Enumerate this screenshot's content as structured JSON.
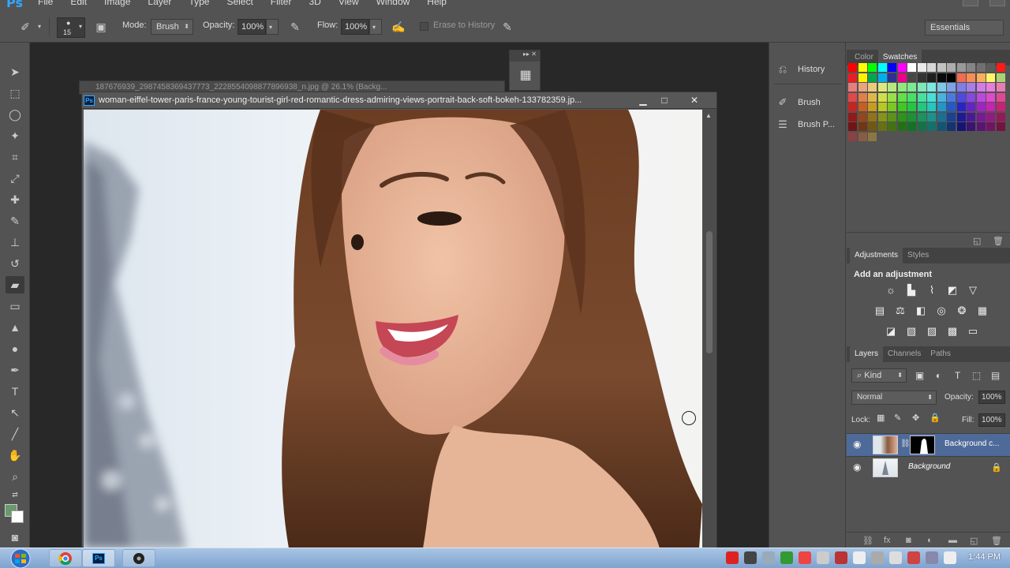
{
  "app": {
    "logo": "Ps"
  },
  "menu": {
    "items": [
      "File",
      "Edit",
      "Image",
      "Layer",
      "Type",
      "Select",
      "Filter",
      "3D",
      "View",
      "Window",
      "Help"
    ]
  },
  "options": {
    "brush_size": "15",
    "mode_label": "Mode:",
    "mode_value": "Brush",
    "opacity_label": "Opacity:",
    "opacity_value": "100%",
    "flow_label": "Flow:",
    "flow_value": "100%",
    "erase_history": "Erase to History",
    "workspace": "Essentials"
  },
  "document": {
    "back_title": "187676939_2987458369437773_2228554098877896938_n.jpg @ 26.1% (Backg...",
    "title": "woman-eiffel-tower-paris-france-young-tourist-girl-red-romantic-dress-admiring-views-portrait-back-soft-bokeh-133782359.jp..."
  },
  "dock": {
    "items": [
      "History",
      "Brush",
      "Brush P..."
    ]
  },
  "color_panel": {
    "tabs": [
      "Color",
      "Swatches"
    ],
    "active": "Swatches"
  },
  "adjustments_panel": {
    "tabs": [
      "Adjustments",
      "Styles"
    ],
    "header": "Add an adjustment"
  },
  "layers_panel": {
    "tabs": [
      "Layers",
      "Channels",
      "Paths"
    ],
    "filter": "Kind",
    "blend_mode": "Normal",
    "opacity_label": "Opacity:",
    "opacity_value": "100%",
    "lock_label": "Lock:",
    "fill_label": "Fill:",
    "fill_value": "100%",
    "layers": [
      {
        "name": "Background c...",
        "selected": true
      },
      {
        "name": "Background",
        "selected": false
      }
    ]
  },
  "taskbar": {
    "clock": "1:44 PM"
  },
  "colors": {
    "ui_bg": "#535353",
    "selection": "#4e6a99",
    "ps_blue": "#31a8ff"
  }
}
